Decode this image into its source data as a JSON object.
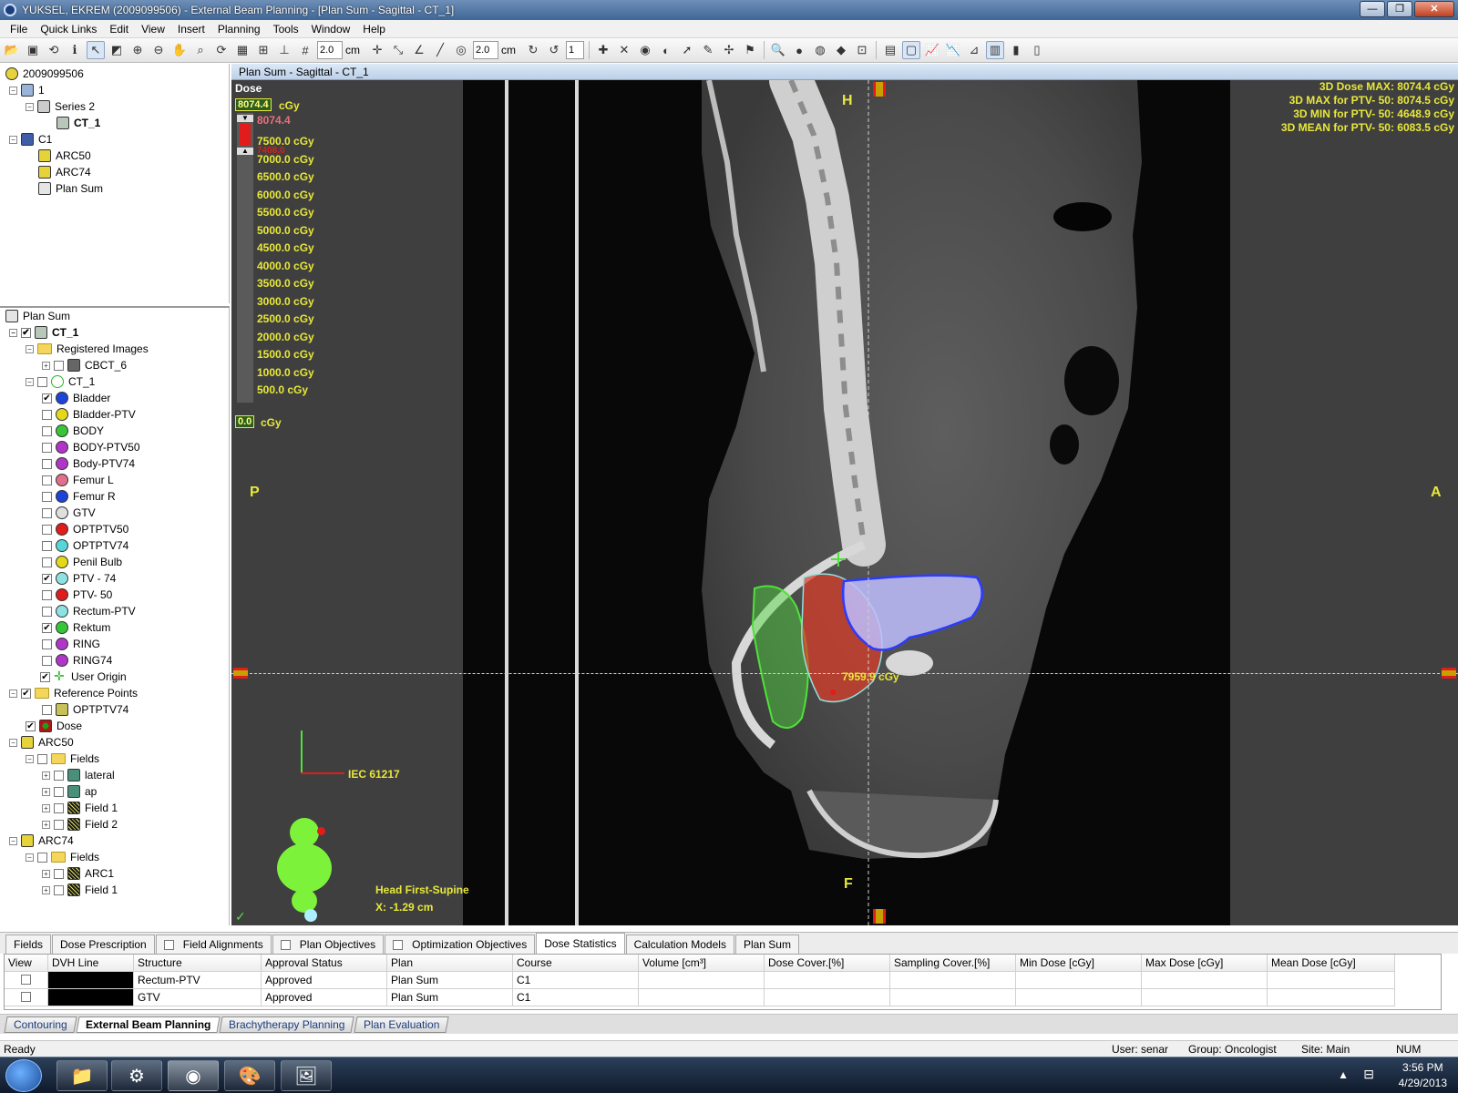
{
  "window": {
    "title": "YUKSEL, EKREM (2009099506) - External Beam Planning - [Plan Sum - Sagittal - CT_1]",
    "buttons": [
      "—",
      "❐",
      "✕"
    ]
  },
  "menu": [
    "File",
    "Quick Links",
    "Edit",
    "View",
    "Insert",
    "Planning",
    "Tools",
    "Window",
    "Help"
  ],
  "toolbar": {
    "grid_value1": "2.0",
    "unit1": "cm",
    "grid_value2": "2.0",
    "unit2": "cm",
    "field_value": "1"
  },
  "tree_top": {
    "patient_id": "2009099506",
    "items": [
      {
        "label": "1"
      },
      {
        "label": "Series 2"
      },
      {
        "label": "CT_1"
      },
      {
        "label": "C1"
      },
      {
        "label": "ARC50"
      },
      {
        "label": "ARC74"
      },
      {
        "label": "Plan Sum"
      }
    ]
  },
  "tree_bottom": {
    "root": "Plan Sum",
    "ct": "CT_1",
    "registered": "Registered Images",
    "cbct": "CBCT_6",
    "structset": "CT_1",
    "structures": [
      {
        "label": "Bladder",
        "color": "#1d44d8",
        "checked": "✔"
      },
      {
        "label": "Bladder-PTV",
        "color": "#e4d81c",
        "checked": ""
      },
      {
        "label": "BODY",
        "color": "#37c637",
        "checked": ""
      },
      {
        "label": "BODY-PTV50",
        "color": "#b036c8",
        "checked": ""
      },
      {
        "label": "Body-PTV74",
        "color": "#b036c8",
        "checked": ""
      },
      {
        "label": "Femur L",
        "color": "#e0708c",
        "checked": ""
      },
      {
        "label": "Femur R",
        "color": "#1d44d8",
        "checked": ""
      },
      {
        "label": "GTV",
        "color": "#dfdfdf",
        "checked": ""
      },
      {
        "label": "OPTPTV50",
        "color": "#e01c1c",
        "checked": ""
      },
      {
        "label": "OPTPTV74",
        "color": "#55d7d7",
        "checked": ""
      },
      {
        "label": "Penil Bulb",
        "color": "#e4d81c",
        "checked": ""
      },
      {
        "label": "PTV - 74",
        "color": "#8fe2e2",
        "checked": "✔"
      },
      {
        "label": "PTV- 50",
        "color": "#e01c1c",
        "checked": ""
      },
      {
        "label": "Rectum-PTV",
        "color": "#8fe2e2",
        "checked": ""
      },
      {
        "label": "Rektum",
        "color": "#37c637",
        "checked": "✔"
      },
      {
        "label": "RING",
        "color": "#b036c8",
        "checked": ""
      },
      {
        "label": "RING74",
        "color": "#b036c8",
        "checked": ""
      }
    ],
    "user_origin": "User Origin",
    "reference_points": "Reference Points",
    "ref_optptv74": "OPTPTV74",
    "dose": "Dose",
    "arc50": "ARC50",
    "fields": "Fields",
    "arc50_fields": [
      "lateral",
      "ap",
      "Field 1",
      "Field 2"
    ],
    "arc74": "ARC74",
    "fields2": "Fields",
    "arc74_fields": [
      "ARC1",
      "Field 1"
    ]
  },
  "viewer": {
    "title": "Plan Sum - Sagittal - CT_1",
    "dose_label": "Dose",
    "dose_max_value": "8074.4",
    "dose_unit": "cGy",
    "dose_max_red": "8074.4",
    "dose_overlap": "7408.0",
    "legend": [
      "7500.0 cGy",
      "7000.0 cGy",
      "6500.0 cGy",
      "6000.0 cGy",
      "5500.0 cGy",
      "5000.0 cGy",
      "4500.0 cGy",
      "4000.0 cGy",
      "3500.0 cGy",
      "3000.0 cGy",
      "2500.0 cGy",
      "2000.0 cGy",
      "1500.0 cGy",
      "1000.0 cGy",
      "500.0 cGy"
    ],
    "dose_min_value": "0.0",
    "dose_min_unit": "cGy",
    "stats": [
      "3D Dose MAX: 8074.4 cGy",
      "3D MAX for PTV- 50: 8074.5 cGy",
      "3D MIN for PTV- 50: 4648.9 cGy",
      "3D MEAN for PTV- 50: 6083.5 cGy"
    ],
    "orient_h": "H",
    "orient_f": "F",
    "orient_p": "P",
    "orient_a": "A",
    "iec": "IEC 61217",
    "point_dose": "7959.9 cGy",
    "position": "Head First-Supine",
    "xcoord": "X: -1.29 cm"
  },
  "bottom_tabs": [
    {
      "label": "Fields",
      "check": false
    },
    {
      "label": "Dose Prescription",
      "check": false
    },
    {
      "label": "Field Alignments",
      "check": true
    },
    {
      "label": "Plan Objectives",
      "check": true
    },
    {
      "label": "Optimization Objectives",
      "check": true
    },
    {
      "label": "Dose Statistics",
      "check": false
    },
    {
      "label": "Calculation Models",
      "check": false
    },
    {
      "label": "Plan Sum",
      "check": false
    }
  ],
  "table": {
    "headers": [
      "View",
      "DVH Line",
      "Structure",
      "Approval Status",
      "Plan",
      "Course",
      "Volume [cm³]",
      "Dose Cover.[%]",
      "Sampling Cover.[%]",
      "Min Dose [cGy]",
      "Max Dose [cGy]",
      "Mean Dose [cGy]"
    ],
    "rows": [
      [
        "",
        "",
        "Rectum-PTV",
        "Approved",
        "Plan Sum",
        "C1",
        "",
        "",
        "",
        "",
        "",
        ""
      ],
      [
        "",
        "",
        "GTV",
        "Approved",
        "Plan Sum",
        "C1",
        "",
        "",
        "",
        "",
        "",
        ""
      ]
    ]
  },
  "workspaces": [
    "Contouring",
    "External Beam Planning",
    "Brachytherapy Planning",
    "Plan Evaluation"
  ],
  "status": {
    "left": "Ready",
    "user": "User: senar",
    "group": "Group: Oncologist",
    "site": "Site: Main",
    "num": "NUM"
  },
  "taskbar": {
    "time": "3:56 PM",
    "date": "4/29/2013"
  }
}
